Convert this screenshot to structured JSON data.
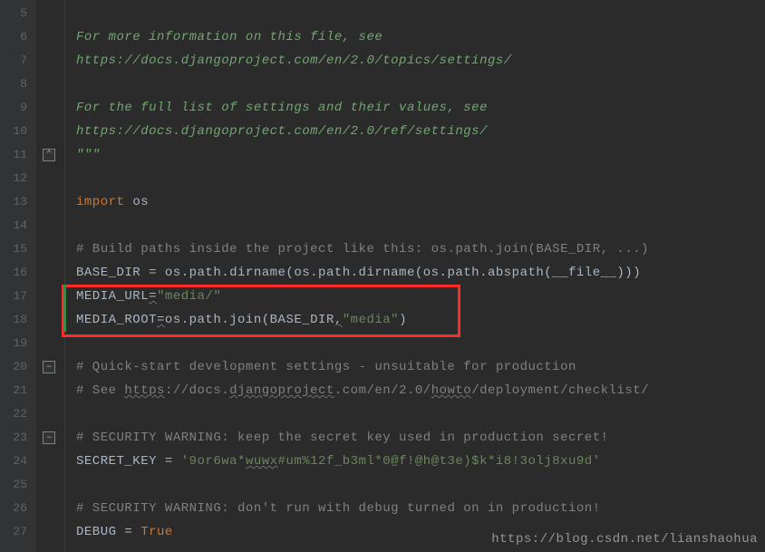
{
  "gutter": {
    "start": 5,
    "end": 27
  },
  "fold_markers": [
    {
      "line": 11,
      "glyph": "⌃"
    },
    {
      "line": 20,
      "glyph": "–"
    },
    {
      "line": 23,
      "glyph": "–"
    }
  ],
  "modified_lines": [
    17,
    18
  ],
  "highlight_box_lines": [
    17,
    18
  ],
  "code": {
    "l5": [
      {
        "cls": "c-docstring",
        "t": ""
      }
    ],
    "l6": [
      {
        "cls": "c-docstring",
        "t": "For more information on this file, see"
      }
    ],
    "l7": [
      {
        "cls": "c-docstring",
        "t": "https://docs.djangoproject.com/en/2.0/topics/settings/"
      }
    ],
    "l8": [
      {
        "cls": "c-docstring",
        "t": ""
      }
    ],
    "l9": [
      {
        "cls": "c-docstring",
        "t": "For the full list of settings and their values, see"
      }
    ],
    "l10": [
      {
        "cls": "c-docstring",
        "t": "https://docs.djangoproject.com/en/2.0/ref/settings/"
      }
    ],
    "l11": [
      {
        "cls": "c-docstring",
        "t": "\"\"\""
      }
    ],
    "l12": [
      {
        "cls": "c-default",
        "t": ""
      }
    ],
    "l13": [
      {
        "cls": "c-keyword",
        "t": "import"
      },
      {
        "cls": "c-default",
        "t": " os"
      }
    ],
    "l14": [
      {
        "cls": "c-default",
        "t": ""
      }
    ],
    "l15": [
      {
        "cls": "c-comment",
        "t": "# Build paths inside the project like this: os.path.join(BASE_DIR, ...)"
      }
    ],
    "l16": [
      {
        "cls": "c-default",
        "t": "BASE_DIR = os.path.dirname(os.path.dirname(os.path.abspath(__file__)))"
      }
    ],
    "l17": [
      {
        "cls": "c-default",
        "t": "MEDIA_URL"
      },
      {
        "cls": "c-default wavy",
        "t": "="
      },
      {
        "cls": "c-string",
        "t": "\"media/\""
      }
    ],
    "l18": [
      {
        "cls": "c-default",
        "t": "MEDIA_ROOT"
      },
      {
        "cls": "c-default wavy",
        "t": "="
      },
      {
        "cls": "c-default",
        "t": "os.path.join(BASE_DIR"
      },
      {
        "cls": "c-default wavy",
        "t": ","
      },
      {
        "cls": "c-string",
        "t": "\"media\""
      },
      {
        "cls": "c-default",
        "t": ")"
      }
    ],
    "l19": [
      {
        "cls": "c-default",
        "t": ""
      }
    ],
    "l20": [
      {
        "cls": "c-comment",
        "t": "# Quick-start development settings - unsuitable for production"
      }
    ],
    "l21": [
      {
        "cls": "c-comment",
        "t": "# See "
      },
      {
        "cls": "c-comment wavy",
        "t": "https"
      },
      {
        "cls": "c-comment",
        "t": "://docs."
      },
      {
        "cls": "c-comment wavy",
        "t": "djangoproject"
      },
      {
        "cls": "c-comment",
        "t": ".com/en/2.0/"
      },
      {
        "cls": "c-comment wavy",
        "t": "howto"
      },
      {
        "cls": "c-comment",
        "t": "/deployment/checklist/"
      }
    ],
    "l22": [
      {
        "cls": "c-default",
        "t": ""
      }
    ],
    "l23": [
      {
        "cls": "c-comment",
        "t": "# SECURITY WARNING: keep the secret key used in production secret!"
      }
    ],
    "l24": [
      {
        "cls": "c-default",
        "t": "SECRET_KEY = "
      },
      {
        "cls": "c-string",
        "t": "'9or6wa*"
      },
      {
        "cls": "c-string wavy",
        "t": "wuwx"
      },
      {
        "cls": "c-string",
        "t": "#um%12f_b3ml*0@f!@h@t3e)$k*i8!3olj8xu9d'"
      }
    ],
    "l25": [
      {
        "cls": "c-default",
        "t": ""
      }
    ],
    "l26": [
      {
        "cls": "c-comment",
        "t": "# SECURITY WARNING: don't run with debug turned on in production!"
      }
    ],
    "l27": [
      {
        "cls": "c-default",
        "t": "DEBUG = "
      },
      {
        "cls": "c-builtin",
        "t": "True"
      }
    ]
  },
  "watermark": "https://blog.csdn.net/lianshaohua"
}
